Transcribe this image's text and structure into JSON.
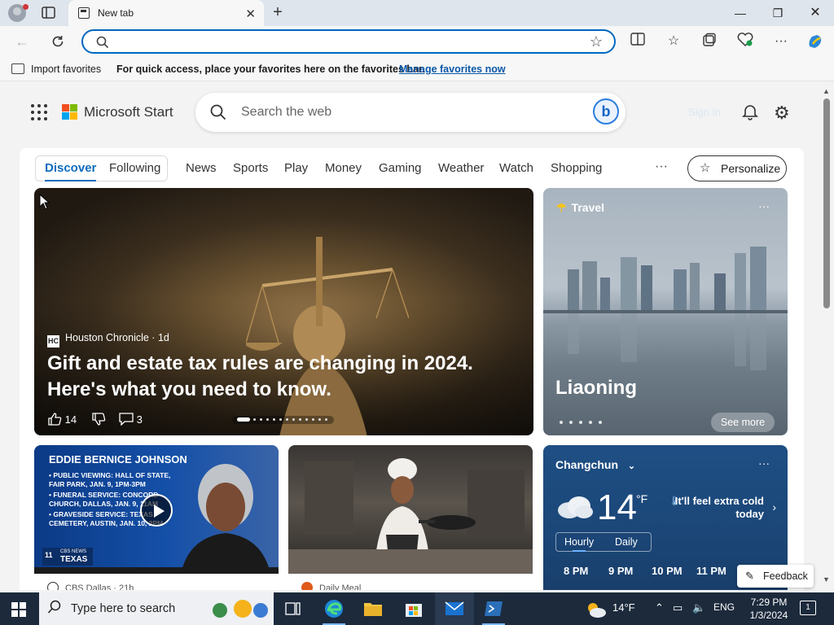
{
  "browser": {
    "tab_title": "New tab",
    "address_value": "",
    "favorites": {
      "import_label": "Import favorites",
      "message": "For quick access, place your favorites here on the favorites bar.",
      "manage_link": "Manage favorites now"
    }
  },
  "header": {
    "brand": "Microsoft Start",
    "search_placeholder": "Search the web",
    "bing_label": "b",
    "sign_in": "Sign in"
  },
  "nav": {
    "items": [
      "Discover",
      "Following",
      "News",
      "Sports",
      "Play",
      "Money",
      "Gaming",
      "Weather",
      "Watch",
      "Shopping"
    ],
    "active": "Discover",
    "more": "···",
    "personalize": "Personalize"
  },
  "hero": {
    "source_logo": "HC",
    "source": "Houston Chronicle · 1d",
    "title": "Gift and estate tax rules are changing in 2024. Here's what you need to know.",
    "likes": "14",
    "comments": "3",
    "carousel_total": 13,
    "carousel_index": 1
  },
  "travel": {
    "label": "Travel",
    "city": "Liaoning",
    "see_more": "See more",
    "more": "···"
  },
  "card1": {
    "headline": "EDDIE BERNICE JOHNSON",
    "lines": [
      "• PUBLIC VIEWING: HALL OF STATE, FAIR PARK, JAN. 9, 1PM-3PM",
      "• FUNERAL SERVICE: CONCORD CHURCH, DALLAS, JAN. 9, 11AM",
      "• GRAVESIDE SERVICE: TEXAS CEMETERY, AUSTIN, JAN. 10, 2PM"
    ],
    "badge_top": "CBS NEWS",
    "badge_main": "TEXAS",
    "channel": "11",
    "source": "CBS Dallas · 21h"
  },
  "card2": {
    "source": "Daily Meal"
  },
  "weather": {
    "city": "Changchun",
    "temp": "14",
    "unit": "°F",
    "feel": "It'll feel extra cold today",
    "tabs": [
      "Hourly",
      "Daily"
    ],
    "hours": [
      "8 PM",
      "9 PM",
      "10 PM",
      "11 PM"
    ],
    "more": "···"
  },
  "feedback": "Feedback",
  "taskbar": {
    "search_placeholder": "Type here to search",
    "tray_temp": "14°F",
    "language": "ENG",
    "time": "7:29 PM",
    "date": "1/3/2024",
    "notifications": "1"
  }
}
